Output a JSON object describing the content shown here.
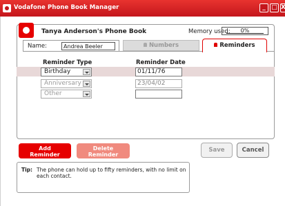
{
  "window": {
    "title": "Vodafone Phone Book Manager",
    "minimize_glyph": "_",
    "maximize_glyph": "□",
    "close_glyph": "X"
  },
  "header": {
    "phone_book_title": "Tanya Anderson's Phone Book",
    "memory_label": "Memory used:",
    "memory_value": "0%"
  },
  "contact": {
    "name_label": "Name:",
    "name_value": "Andrea Beeler"
  },
  "tabs": [
    {
      "label": "Numbers",
      "active": false
    },
    {
      "label": "Reminders",
      "active": true
    }
  ],
  "table": {
    "columns": [
      "Reminder Type",
      "Reminder Date"
    ],
    "rows": [
      {
        "type": "Birthday",
        "date": "01/11/76",
        "selected": true
      },
      {
        "type": "Anniversary",
        "date": "23/04/02",
        "selected": false
      },
      {
        "type": "Other",
        "date": "",
        "selected": false
      }
    ]
  },
  "buttons": {
    "add_line1": "Add",
    "add_line2": "Reminder",
    "delete_line1": "Delete",
    "delete_line2": "Reminder",
    "save": "Save",
    "cancel": "Cancel"
  },
  "tip": {
    "label": "Tip:",
    "text": "The phone can hold up to fifty reminders, with no limit on each contact."
  },
  "colors": {
    "brand_red": "#e60000",
    "delete_disabled": "#f08a7e",
    "selected_row": "#e8d8d8"
  },
  "icons": [
    "vodafone-logo-icon",
    "bell-icon",
    "window-minimize-icon",
    "window-maximize-icon",
    "window-close-icon",
    "dropdown-arrow-icon"
  ]
}
